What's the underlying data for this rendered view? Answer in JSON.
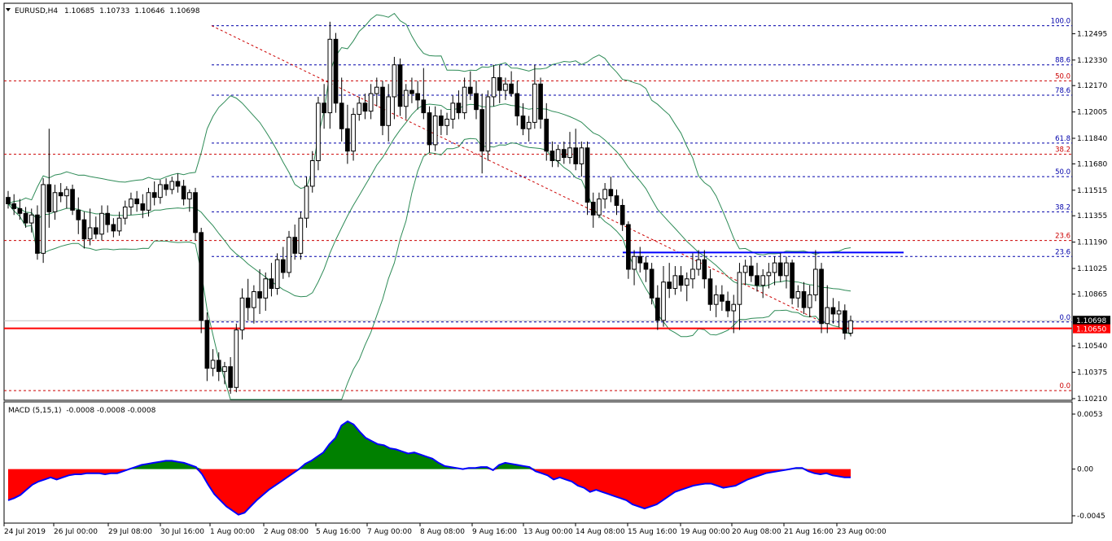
{
  "symbol_header": {
    "symbol": "EURUSD,H4",
    "open": "1.10685",
    "high": "1.10733",
    "low": "1.10646",
    "close": "1.10698",
    "menu_icon": "triangle-down-icon"
  },
  "indicator_header": {
    "name": "MACD (5,15,1)",
    "values": "-0.0008 -0.0008 -0.0008"
  },
  "colors": {
    "background": "#ffffff",
    "frame": "#000000",
    "bollinger": "#2e8b57",
    "fibo_red": "#cc0000",
    "fibo_blue": "#0000aa",
    "support_line": "#ff0000",
    "resistance_line": "#0000ff",
    "macd_positive": "#008000",
    "macd_negative": "#ff0000",
    "macd_signal": "#0000ff"
  },
  "chart_data": [
    {
      "type": "candlestick",
      "title": "EURUSD,H4",
      "y_range": [
        1.1021,
        1.1265
      ],
      "y_ticks": [
        "1.12495",
        "1.12330",
        "1.12170",
        "1.12005",
        "1.11840",
        "1.11680",
        "1.11515",
        "1.11355",
        "1.11190",
        "1.11025",
        "1.10865",
        "1.10540",
        "1.10375",
        "1.10210"
      ],
      "x_ticks": [
        "24 Jul 2019",
        "26 Jul 00:00",
        "29 Jul 08:00",
        "30 Jul 16:00",
        "1 Aug 00:00",
        "2 Aug 08:00",
        "5 Aug 16:00",
        "7 Aug 00:00",
        "8 Aug 08:00",
        "9 Aug 16:00",
        "13 Aug 00:00",
        "14 Aug 08:00",
        "15 Aug 16:00",
        "19 Aug 00:00",
        "20 Aug 08:00",
        "21 Aug 16:00",
        "23 Aug 00:00"
      ],
      "current_price_label": "1.10698",
      "support_price_label": "1.10650",
      "fibo_levels_red": [
        {
          "label": "50.0",
          "price": 1.122
        },
        {
          "label": "38.2",
          "price": 1.1174
        },
        {
          "label": "23.6",
          "price": 1.112
        },
        {
          "label": "0.0",
          "price": 1.1026
        }
      ],
      "fibo_levels_blue": [
        {
          "label": "100.0",
          "price": 1.12545
        },
        {
          "label": "88.6",
          "price": 1.123
        },
        {
          "label": "78.6",
          "price": 1.1211
        },
        {
          "label": "61.8",
          "price": 1.1181
        },
        {
          "label": "50.0",
          "price": 1.116
        },
        {
          "label": "38.2",
          "price": 1.1138
        },
        {
          "label": "23.6",
          "price": 1.111
        },
        {
          "label": "0.0",
          "price": 1.1069
        }
      ],
      "candles": [
        [
          1.1147,
          1.1151,
          1.114,
          1.1143
        ],
        [
          1.1143,
          1.1149,
          1.1136,
          1.114
        ],
        [
          1.114,
          1.1146,
          1.1133,
          1.1137
        ],
        [
          1.1137,
          1.1141,
          1.1128,
          1.1131
        ],
        [
          1.1131,
          1.114,
          1.1125,
          1.1136
        ],
        [
          1.1136,
          1.1142,
          1.1108,
          1.1112
        ],
        [
          1.1112,
          1.1159,
          1.1106,
          1.1155
        ],
        [
          1.1155,
          1.119,
          1.1128,
          1.1138
        ],
        [
          1.1138,
          1.1155,
          1.1133,
          1.115
        ],
        [
          1.115,
          1.1156,
          1.1144,
          1.1148
        ],
        [
          1.1148,
          1.1154,
          1.114,
          1.1152
        ],
        [
          1.1152,
          1.1155,
          1.1136,
          1.1139
        ],
        [
          1.1139,
          1.1147,
          1.1124,
          1.1133
        ],
        [
          1.1133,
          1.1138,
          1.1115,
          1.1121
        ],
        [
          1.1121,
          1.114,
          1.1117,
          1.1128
        ],
        [
          1.1128,
          1.1135,
          1.1121,
          1.1124
        ],
        [
          1.1124,
          1.1142,
          1.112,
          1.1137
        ],
        [
          1.1137,
          1.1142,
          1.1125,
          1.113
        ],
        [
          1.113,
          1.1134,
          1.1122,
          1.1126
        ],
        [
          1.1126,
          1.1138,
          1.1123,
          1.1134
        ],
        [
          1.1134,
          1.1145,
          1.113,
          1.1141
        ],
        [
          1.1141,
          1.115,
          1.1136,
          1.1146
        ],
        [
          1.1146,
          1.1151,
          1.1138,
          1.1143
        ],
        [
          1.1143,
          1.1149,
          1.1134,
          1.1139
        ],
        [
          1.1139,
          1.1153,
          1.1135,
          1.115
        ],
        [
          1.115,
          1.1157,
          1.1142,
          1.1147
        ],
        [
          1.1147,
          1.1158,
          1.1143,
          1.1155
        ],
        [
          1.1155,
          1.1159,
          1.1148,
          1.1152
        ],
        [
          1.1152,
          1.116,
          1.1149,
          1.1157
        ],
        [
          1.1157,
          1.1162,
          1.115,
          1.1154
        ],
        [
          1.1154,
          1.1158,
          1.1142,
          1.1146
        ],
        [
          1.1146,
          1.1152,
          1.1138,
          1.115
        ],
        [
          1.115,
          1.1153,
          1.112,
          1.1125
        ],
        [
          1.1125,
          1.1128,
          1.1062,
          1.107
        ],
        [
          1.107,
          1.1075,
          1.1032,
          1.104
        ],
        [
          1.104,
          1.1052,
          1.1035,
          1.1045
        ],
        [
          1.1045,
          1.105,
          1.1032,
          1.1038
        ],
        [
          1.1038,
          1.1044,
          1.103,
          1.1041
        ],
        [
          1.1041,
          1.1047,
          1.1024,
          1.1028
        ],
        [
          1.1028,
          1.1068,
          1.1025,
          1.1064
        ],
        [
          1.1064,
          1.109,
          1.1058,
          1.1084
        ],
        [
          1.1084,
          1.1096,
          1.107,
          1.1078
        ],
        [
          1.1078,
          1.1092,
          1.1068,
          1.1088
        ],
        [
          1.1088,
          1.1102,
          1.1074,
          1.1084
        ],
        [
          1.1084,
          1.11,
          1.1076,
          1.1096
        ],
        [
          1.1096,
          1.1106,
          1.1085,
          1.109
        ],
        [
          1.109,
          1.1112,
          1.1086,
          1.1108
        ],
        [
          1.1108,
          1.1116,
          1.1096,
          1.11
        ],
        [
          1.11,
          1.1126,
          1.1097,
          1.1122
        ],
        [
          1.1122,
          1.113,
          1.1108,
          1.1112
        ],
        [
          1.1112,
          1.1138,
          1.1108,
          1.1134
        ],
        [
          1.1134,
          1.116,
          1.1128,
          1.1154
        ],
        [
          1.1154,
          1.1176,
          1.115,
          1.117
        ],
        [
          1.117,
          1.121,
          1.1164,
          1.1206
        ],
        [
          1.1206,
          1.1218,
          1.119,
          1.12
        ],
        [
          1.12,
          1.1257,
          1.119,
          1.1246
        ],
        [
          1.1246,
          1.125,
          1.12,
          1.1206
        ],
        [
          1.1206,
          1.1222,
          1.1182,
          1.119
        ],
        [
          1.119,
          1.1205,
          1.1168,
          1.1176
        ],
        [
          1.1176,
          1.1203,
          1.117,
          1.1199
        ],
        [
          1.1199,
          1.121,
          1.1195,
          1.1206
        ],
        [
          1.1206,
          1.1212,
          1.1196,
          1.1201
        ],
        [
          1.1201,
          1.1218,
          1.1196,
          1.1212
        ],
        [
          1.1212,
          1.1222,
          1.1204,
          1.1216
        ],
        [
          1.1216,
          1.122,
          1.1186,
          1.1192
        ],
        [
          1.1192,
          1.1218,
          1.1182,
          1.121
        ],
        [
          1.121,
          1.1235,
          1.1196,
          1.123
        ],
        [
          1.123,
          1.1234,
          1.1198,
          1.1204
        ],
        [
          1.1204,
          1.1218,
          1.1196,
          1.1214
        ],
        [
          1.1214,
          1.1222,
          1.1206,
          1.1212
        ],
        [
          1.1212,
          1.122,
          1.1202,
          1.1208
        ],
        [
          1.1208,
          1.1228,
          1.1196,
          1.12
        ],
        [
          1.12,
          1.1204,
          1.1175,
          1.118
        ],
        [
          1.118,
          1.1204,
          1.1176,
          1.1198
        ],
        [
          1.1198,
          1.1202,
          1.1186,
          1.1192
        ],
        [
          1.1192,
          1.12,
          1.1186,
          1.1196
        ],
        [
          1.1196,
          1.1211,
          1.119,
          1.1206
        ],
        [
          1.1206,
          1.1214,
          1.1196,
          1.12
        ],
        [
          1.12,
          1.1222,
          1.1196,
          1.1216
        ],
        [
          1.1216,
          1.1226,
          1.1208,
          1.1212
        ],
        [
          1.1212,
          1.122,
          1.1196,
          1.1202
        ],
        [
          1.1202,
          1.1212,
          1.1162,
          1.1176
        ],
        [
          1.1176,
          1.1214,
          1.117,
          1.121
        ],
        [
          1.121,
          1.123,
          1.1204,
          1.1222
        ],
        [
          1.1222,
          1.123,
          1.1206,
          1.1214
        ],
        [
          1.1214,
          1.1222,
          1.1208,
          1.1218
        ],
        [
          1.1218,
          1.1226,
          1.121,
          1.1212
        ],
        [
          1.1212,
          1.122,
          1.1192,
          1.1198
        ],
        [
          1.1198,
          1.1206,
          1.1186,
          1.119
        ],
        [
          1.119,
          1.1198,
          1.1182,
          1.1194
        ],
        [
          1.1194,
          1.123,
          1.119,
          1.1218
        ],
        [
          1.1218,
          1.1222,
          1.119,
          1.1196
        ],
        [
          1.1196,
          1.1206,
          1.117,
          1.1176
        ],
        [
          1.1176,
          1.1182,
          1.1166,
          1.117
        ],
        [
          1.117,
          1.118,
          1.1166,
          1.1177
        ],
        [
          1.1177,
          1.1182,
          1.1168,
          1.1172
        ],
        [
          1.1172,
          1.1188,
          1.1168,
          1.1178
        ],
        [
          1.1178,
          1.119,
          1.1164,
          1.1168
        ],
        [
          1.1168,
          1.1182,
          1.116,
          1.1178
        ],
        [
          1.1178,
          1.1182,
          1.1136,
          1.1144
        ],
        [
          1.1144,
          1.115,
          1.1128,
          1.1136
        ],
        [
          1.1136,
          1.115,
          1.1134,
          1.1146
        ],
        [
          1.1146,
          1.1156,
          1.114,
          1.1152
        ],
        [
          1.1152,
          1.116,
          1.1144,
          1.1148
        ],
        [
          1.1148,
          1.1152,
          1.1136,
          1.1142
        ],
        [
          1.1142,
          1.1146,
          1.1126,
          1.113
        ],
        [
          1.113,
          1.1132,
          1.1096,
          1.1102
        ],
        [
          1.1102,
          1.1114,
          1.1092,
          1.111
        ],
        [
          1.111,
          1.1116,
          1.11,
          1.1106
        ],
        [
          1.1106,
          1.111,
          1.1094,
          1.1102
        ],
        [
          1.1102,
          1.1106,
          1.108,
          1.1084
        ],
        [
          1.1084,
          1.1092,
          1.1064,
          1.107
        ],
        [
          1.107,
          1.1104,
          1.1066,
          1.1094
        ],
        [
          1.1094,
          1.1106,
          1.1084,
          1.109
        ],
        [
          1.109,
          1.1104,
          1.1086,
          1.1098
        ],
        [
          1.1098,
          1.1104,
          1.1088,
          1.1092
        ],
        [
          1.1092,
          1.11,
          1.1082,
          1.1096
        ],
        [
          1.1096,
          1.1112,
          1.109,
          1.1102
        ],
        [
          1.1102,
          1.1114,
          1.1098,
          1.1108
        ],
        [
          1.1108,
          1.1114,
          1.109,
          1.1096
        ],
        [
          1.1096,
          1.1102,
          1.1076,
          1.108
        ],
        [
          1.108,
          1.1092,
          1.1072,
          1.1086
        ],
        [
          1.1086,
          1.1092,
          1.1076,
          1.1082
        ],
        [
          1.1082,
          1.1088,
          1.1072,
          1.1076
        ],
        [
          1.1076,
          1.1086,
          1.1062,
          1.108
        ],
        [
          1.108,
          1.1106,
          1.1064,
          1.11
        ],
        [
          1.11,
          1.1108,
          1.1092,
          1.1104
        ],
        [
          1.1104,
          1.111,
          1.1094,
          1.1098
        ],
        [
          1.1098,
          1.1106,
          1.1088,
          1.1092
        ],
        [
          1.1092,
          1.1102,
          1.1084,
          1.1098
        ],
        [
          1.1098,
          1.1106,
          1.109,
          1.11
        ],
        [
          1.11,
          1.111,
          1.1092,
          1.1106
        ],
        [
          1.1106,
          1.1112,
          1.1094,
          1.1098
        ],
        [
          1.1098,
          1.111,
          1.109,
          1.1106
        ],
        [
          1.1106,
          1.1108,
          1.108,
          1.1084
        ],
        [
          1.1084,
          1.1092,
          1.1078,
          1.1088
        ],
        [
          1.1088,
          1.1094,
          1.1074,
          1.1078
        ],
        [
          1.1078,
          1.1092,
          1.1072,
          1.1086
        ],
        [
          1.1086,
          1.1114,
          1.1082,
          1.1102
        ],
        [
          1.1102,
          1.1106,
          1.1062,
          1.1068
        ],
        [
          1.1068,
          1.1092,
          1.1062,
          1.1078
        ],
        [
          1.1078,
          1.1084,
          1.1068,
          1.1074
        ],
        [
          1.1074,
          1.1082,
          1.1066,
          1.1076
        ],
        [
          1.1076,
          1.108,
          1.1058,
          1.1062
        ],
        [
          1.1062,
          1.1073,
          1.106,
          1.10698
        ]
      ]
    },
    {
      "type": "histogram",
      "title": "MACD (5,15,1)",
      "y_range": [
        -0.0045,
        0.0053
      ],
      "y_ticks": [
        "0.0053",
        "0.00",
        "-0.0045"
      ],
      "values": [
        -0.003,
        -0.0028,
        -0.0025,
        -0.002,
        -0.0015,
        -0.0012,
        -0.001,
        -0.0008,
        -0.001,
        -0.0008,
        -0.0006,
        -0.0005,
        -0.0005,
        -0.0004,
        -0.0004,
        -0.0004,
        -0.0005,
        -0.0004,
        -0.0004,
        -0.0002,
        0.0,
        0.0002,
        0.0004,
        0.0005,
        0.0006,
        0.0007,
        0.0008,
        0.0008,
        0.0007,
        0.0006,
        0.0004,
        0.0002,
        -0.0005,
        -0.0015,
        -0.0024,
        -0.003,
        -0.0036,
        -0.004,
        -0.0044,
        -0.0042,
        -0.0036,
        -0.003,
        -0.0025,
        -0.002,
        -0.0016,
        -0.0012,
        -0.0008,
        -0.0004,
        0.0,
        0.0005,
        0.0008,
        0.0012,
        0.0016,
        0.0024,
        0.003,
        0.0042,
        0.0046,
        0.0043,
        0.0036,
        0.003,
        0.0027,
        0.0024,
        0.0023,
        0.002,
        0.0019,
        0.0017,
        0.0015,
        0.0016,
        0.0014,
        0.0012,
        0.001,
        0.0006,
        0.0003,
        0.0002,
        0.0001,
        0.0,
        0.0001,
        0.0001,
        0.0002,
        0.0002,
        -0.0001,
        0.0004,
        0.0006,
        0.0005,
        0.0004,
        0.0003,
        0.0002,
        -0.0002,
        -0.0004,
        -0.0006,
        -0.001,
        -0.0008,
        -0.001,
        -0.0012,
        -0.0016,
        -0.0018,
        -0.0022,
        -0.002,
        -0.0022,
        -0.0024,
        -0.0026,
        -0.0028,
        -0.003,
        -0.0034,
        -0.0036,
        -0.0038,
        -0.0036,
        -0.0034,
        -0.003,
        -0.0026,
        -0.0022,
        -0.002,
        -0.0018,
        -0.0016,
        -0.0015,
        -0.0014,
        -0.0014,
        -0.0016,
        -0.0018,
        -0.0017,
        -0.0016,
        -0.0013,
        -0.001,
        -0.0008,
        -0.0006,
        -0.0004,
        -0.0003,
        -0.0002,
        -0.0001,
        0.0,
        0.0001,
        0.0001,
        -0.0002,
        -0.0004,
        -0.0005,
        -0.0004,
        -0.0006,
        -0.0007,
        -0.0008,
        -0.0008
      ]
    }
  ]
}
